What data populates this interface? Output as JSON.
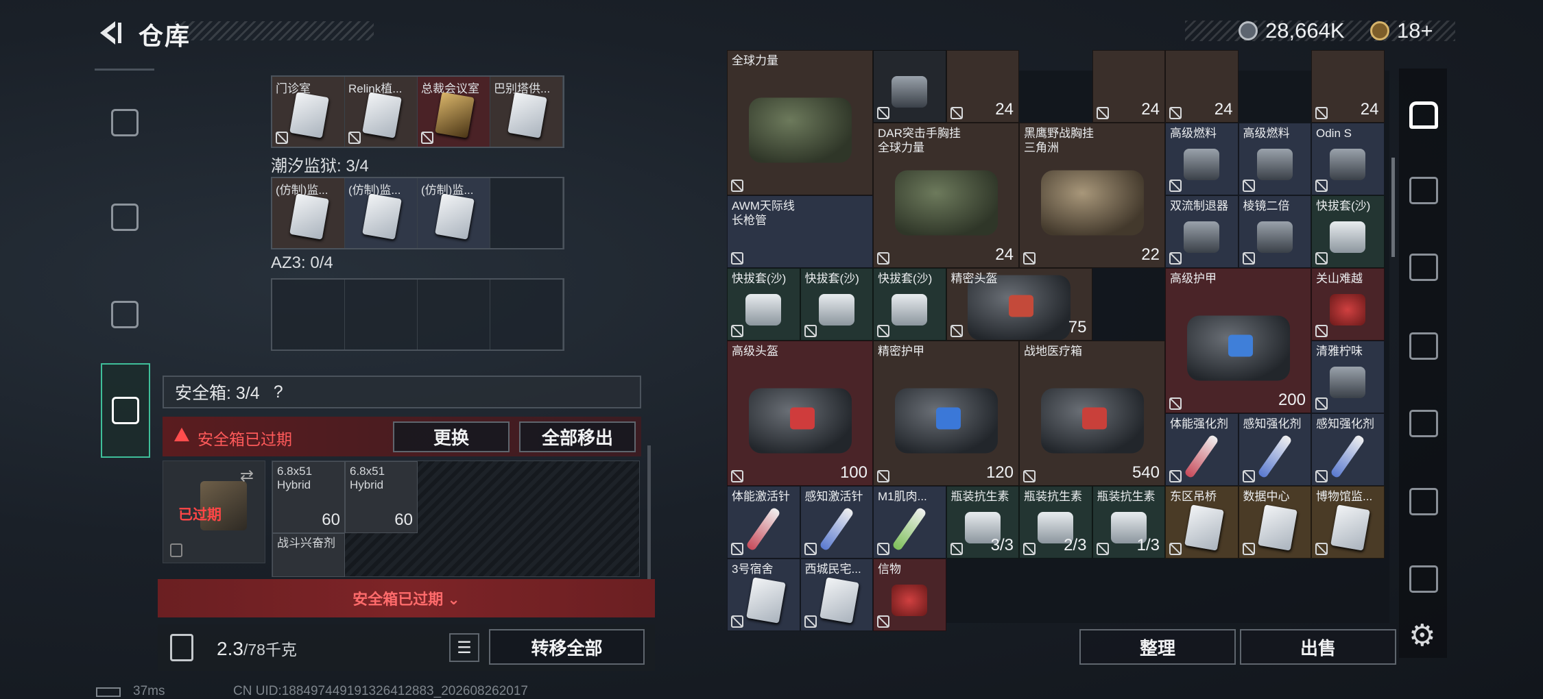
{
  "header": {
    "title": "仓库",
    "money": "28,664K",
    "tickets": "18+"
  },
  "left_rail": {
    "items": [
      "weapon",
      "armor",
      "backpack",
      "safe-box"
    ]
  },
  "locations": {
    "top_row": [
      "门诊室",
      "Relink植...",
      "总裁会议室",
      "巴别塔供..."
    ],
    "tide_prison_label": "潮汐监狱: 3/4",
    "tide_prison": [
      "(仿制)监...",
      "(仿制)监...",
      "(仿制)监..."
    ],
    "az3_label": "AZ3: 0/4"
  },
  "safebox": {
    "label": "安全箱: 3/4",
    "help": "?",
    "expired_warning": "安全箱已过期",
    "replace": "更换",
    "remove_all": "全部移出",
    "box_status": "已过期",
    "items": [
      {
        "name": "6.8x51\nHybrid",
        "count": "60"
      },
      {
        "name": "6.8x51\nHybrid",
        "count": "60"
      },
      {
        "name": "战斗兴奋剂",
        "count": ""
      }
    ],
    "banner": "安全箱已过期 ⌄"
  },
  "footer_left": {
    "weight": "2.3",
    "weight_unit": "/78千克",
    "transfer_all": "转移全部"
  },
  "stash_cells": [
    {
      "name": "全球力量",
      "count": "",
      "type": "bag",
      "color": "brown"
    },
    {
      "name": "",
      "count": "",
      "type": "small",
      "color": "dark"
    },
    {
      "name": "",
      "count": "24",
      "type": "none",
      "color": "brown"
    },
    {
      "name": "",
      "count": "24",
      "type": "none",
      "color": "brown"
    },
    {
      "name": "",
      "count": "24",
      "type": "none",
      "color": "brown"
    },
    {
      "name": "",
      "count": "24",
      "type": "none",
      "color": "brown"
    },
    {
      "name": "DAR突击手胸挂\n全球力量",
      "count": "24",
      "type": "bag",
      "color": "brown"
    },
    {
      "name": "黑鹰野战胸挂\n三角洲",
      "count": "22",
      "type": "bag",
      "color": "brown"
    },
    {
      "name": "高级燃料",
      "count": "",
      "type": "small",
      "color": "blue"
    },
    {
      "name": "高级燃料",
      "count": "",
      "type": "small",
      "color": "blue"
    },
    {
      "name": "Odin S",
      "count": "",
      "type": "small",
      "color": "blue"
    },
    {
      "name": "AWM天际线\n长枪管",
      "count": "",
      "type": "none",
      "color": "blue"
    },
    {
      "name": "双流制退器",
      "count": "",
      "type": "small",
      "color": "blue"
    },
    {
      "name": "棱镜二倍",
      "count": "",
      "type": "small",
      "color": "blue"
    },
    {
      "name": "快拔套(沙)",
      "count": "",
      "type": "small",
      "color": "green"
    },
    {
      "name": "快拔套(沙)",
      "count": "",
      "type": "small",
      "color": "green"
    },
    {
      "name": "快拔套(沙)",
      "count": "",
      "type": "small",
      "color": "green"
    },
    {
      "name": "快拔套(沙)",
      "count": "",
      "type": "small",
      "color": "green"
    },
    {
      "name": "精密头盔",
      "count": "75",
      "type": "bag",
      "color": "brown"
    },
    {
      "name": "高级护甲",
      "count": "200",
      "type": "bag",
      "color": "red"
    },
    {
      "name": "关山难越",
      "count": "",
      "type": "small",
      "color": "red"
    },
    {
      "name": "清雅柠味",
      "count": "",
      "type": "small",
      "color": "blue"
    },
    {
      "name": "高级头盔",
      "count": "100",
      "type": "bag",
      "color": "red"
    },
    {
      "name": "精密护甲",
      "count": "120",
      "type": "bag",
      "color": "brown"
    },
    {
      "name": "战地医疗箱",
      "count": "540",
      "type": "bag",
      "color": "brown"
    },
    {
      "name": "体能强化剂",
      "count": "",
      "type": "pill",
      "color": "blue"
    },
    {
      "name": "感知强化剂",
      "count": "",
      "type": "pill",
      "color": "blue"
    },
    {
      "name": "感知强化剂",
      "count": "",
      "type": "pill",
      "color": "blue"
    },
    {
      "name": "体能激活针",
      "count": "",
      "type": "pill",
      "color": "blue"
    },
    {
      "name": "感知激活针",
      "count": "",
      "type": "pill",
      "color": "blue"
    },
    {
      "name": "M1肌肉...",
      "count": "",
      "type": "pill",
      "color": "blue"
    },
    {
      "name": "瓶装抗生素",
      "count": "3/3",
      "type": "small",
      "color": "green"
    },
    {
      "name": "瓶装抗生素",
      "count": "2/3",
      "type": "small",
      "color": "green"
    },
    {
      "name": "瓶装抗生素",
      "count": "1/3",
      "type": "small",
      "color": "green"
    },
    {
      "name": "东区吊桥",
      "count": "",
      "type": "card",
      "color": "gold"
    },
    {
      "name": "数据中心",
      "count": "",
      "type": "card",
      "color": "gold"
    },
    {
      "name": "博物馆监...",
      "count": "",
      "type": "card",
      "color": "gold"
    },
    {
      "name": "3号宿舍",
      "count": "",
      "type": "card",
      "color": "blue"
    },
    {
      "name": "西城民宅...",
      "count": "",
      "type": "card",
      "color": "blue"
    },
    {
      "name": "信物",
      "count": "",
      "type": "small",
      "color": "red"
    }
  ],
  "footer_right": {
    "tidy": "整理",
    "sell": "出售"
  },
  "status": {
    "ping": "37ms",
    "uid": "CN UID:188497449191326412883_202608262017"
  }
}
